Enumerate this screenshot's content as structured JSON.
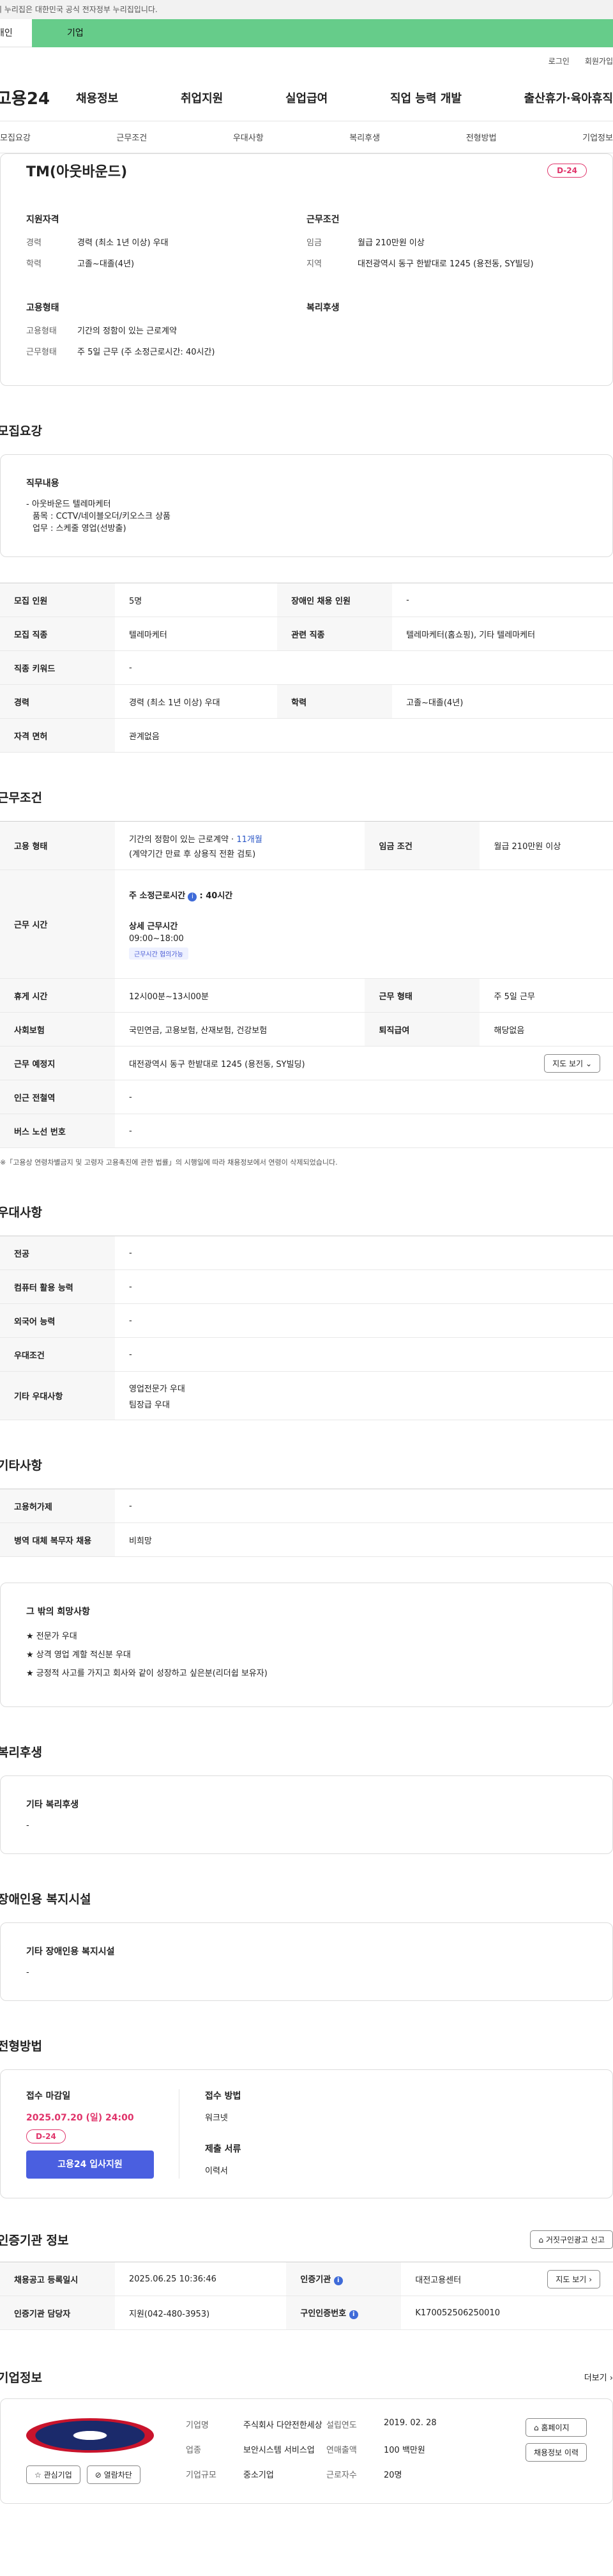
{
  "gov_banner": "이 누리집은 대한민국 공식 전자정부 누리집입니다.",
  "top_tabs": [
    "개인",
    "기업"
  ],
  "util_links": [
    "로그인",
    "회원가입"
  ],
  "logo": "고용24",
  "gnb": [
    "채용정보",
    "취업지원",
    "실업급여",
    "직업 능력 개발",
    "출산휴가·육아휴직"
  ],
  "subnav": [
    "모집요강",
    "근무조건",
    "우대사항",
    "복리후생",
    "전형방법",
    "기업정보"
  ],
  "summary": {
    "title": "TM(아웃바운드)",
    "dday": "D-24",
    "qual_title": "지원자격",
    "cond_title": "근무조건",
    "career_k": "경력",
    "career_v": "경력 (최소 1년 이상) 우대",
    "edu_k": "학력",
    "edu_v": "고졸~대졸(4년)",
    "wage_k": "임금",
    "wage_v": "월급 210만원 이상",
    "region_k": "지역",
    "region_v": "대전광역시 동구 한밭대로 1245 (용전동, SY빌딩)",
    "emp_title": "고용형태",
    "welfare_title": "복리후생",
    "emptype_k": "고용형태",
    "emptype_v": "기간의 정함이 있는 근로계약",
    "workform_k": "근무형태",
    "workform_v": "주 5일 근무 (주 소정근로시간: 40시간)"
  },
  "recruit": {
    "title": "모집요강",
    "job_label": "직무내용",
    "job_lines": [
      "- 아웃바운드 텔레마케터",
      "  품목 : CCTV/네이블오더/키오스크 상품",
      "  업무 : 스케줄 영업(선방출)"
    ],
    "rows": [
      [
        "모집 인원",
        "5명",
        "장애인 채용 인원",
        "-"
      ],
      [
        "모집 직종",
        "텔레마케터",
        "관련 직종",
        "텔레마케터(홈쇼핑), 기타 텔레마케터"
      ],
      [
        "직종 키워드",
        "-",
        "",
        ""
      ],
      [
        "경력",
        "경력 (최소 1년 이상) 우대",
        "학력",
        "고졸~대졸(4년)"
      ],
      [
        "자격 면허",
        "관계없음",
        "",
        ""
      ]
    ]
  },
  "work": {
    "title": "근무조건",
    "emp_k": "고용 형태",
    "emp_v1": "기간의 정함이 있는 근로계약 · ",
    "emp_months": "11개월",
    "emp_v2": "(계약기간 만료 후 상용직 전환 검토)",
    "wage_k": "임금 조건",
    "wage_v": "월급 210만원 이상",
    "hours_k": "근무 시간",
    "hours_week": "주 소정근로시간",
    "hours_week_v": ": 40시간",
    "hours_detail_label": "상세 근무시간",
    "hours_detail": "09:00~18:00",
    "hours_badge": "근무시간 협의가능",
    "rows": [
      [
        "휴게 시간",
        "12시00분~13시00분",
        "근무 형태",
        "주 5일 근무"
      ],
      [
        "사회보험",
        "국민연금, 고용보험, 산재보험, 건강보험",
        "퇴직급여",
        "해당없음"
      ]
    ],
    "place_k": "근무 예정지",
    "place_v": "대전광역시 동구 한밭대로 1245 (용전동, SY빌딩)",
    "map_btn": "지도 보기",
    "subway_k": "인근 전철역",
    "subway_v": "-",
    "bus_k": "버스 노선 번호",
    "bus_v": "-",
    "footnote": "※「고용상 연령차별금지 및 고령자 고용촉진에 관한 법률」의 시행일에 따라 채용정보에서 연령이 삭제되었습니다."
  },
  "prefer": {
    "title": "우대사항",
    "rows": [
      [
        "전공",
        "-"
      ],
      [
        "컴퓨터 활용 능력",
        "-"
      ],
      [
        "외국어 능력",
        "-"
      ],
      [
        "우대조건",
        "-"
      ]
    ],
    "etc_k": "기타 우대사항",
    "etc_v1": "영업전문가 우대",
    "etc_v2": "팀장급 우대"
  },
  "other": {
    "title": "기타사항",
    "rows": [
      [
        "고용허가제",
        "-"
      ],
      [
        "병역 대체 복무자 채용",
        "비희망"
      ]
    ],
    "wish_label": "그 밖의 희망사항",
    "wish_lines": [
      "★ 전문가 우대",
      "★ 상격 영업 계할 적신분 우대",
      "★ 긍정적 사고를 가지고 회사와 같이 성장하고 싶은분(리더쉽 보유자)"
    ]
  },
  "benefit": {
    "title": "복리후생",
    "label": "기타 복리후생",
    "value": "-"
  },
  "disabled": {
    "title": "장애인용 복지시설",
    "label": "기타 장애인용 복지시설",
    "value": "-"
  },
  "process": {
    "title": "전형방법",
    "deadline_label": "접수 마감일",
    "deadline": "2025.07.20 (일) 24:00",
    "dday": "D-24",
    "apply_btn": "고용24 입사지원",
    "method_label": "접수 방법",
    "method": "워크넷",
    "docs_label": "제출 서류",
    "docs": "이력서"
  },
  "cert": {
    "title": "인증기관 정보",
    "report_btn": "거짓구인광고 신고",
    "reg_k": "채용공고 등록일시",
    "reg_v": "2025.06.25 10:36:46",
    "org_k": "인증기관",
    "org_v": "대전고용센터",
    "map_btn": "지도 보기",
    "mgr_k": "인증기관 담당자",
    "mgr_v": "지원(042-480-3953)",
    "num_k": "구인인증번호",
    "num_v": "K170052506250010"
  },
  "corp": {
    "title": "기업정보",
    "more": "더보기",
    "fav_btn": "관심기업",
    "block_btn": "열람차단",
    "name_k": "기업명",
    "name_v": "주식회사 다얀전한세상",
    "founded_k": "설립연도",
    "founded_v": "2019. 02. 28",
    "industry_k": "업종",
    "industry_v": "보안시스템 서비스업",
    "sales_k": "연매출액",
    "sales_v": "100 백만원",
    "staff_k": "근로자수",
    "staff_v": "20명",
    "size_k": "기업규모",
    "size_v": "중소기업",
    "home_btn": "홈페이지",
    "jobs_btn": "채용정보 이력"
  }
}
